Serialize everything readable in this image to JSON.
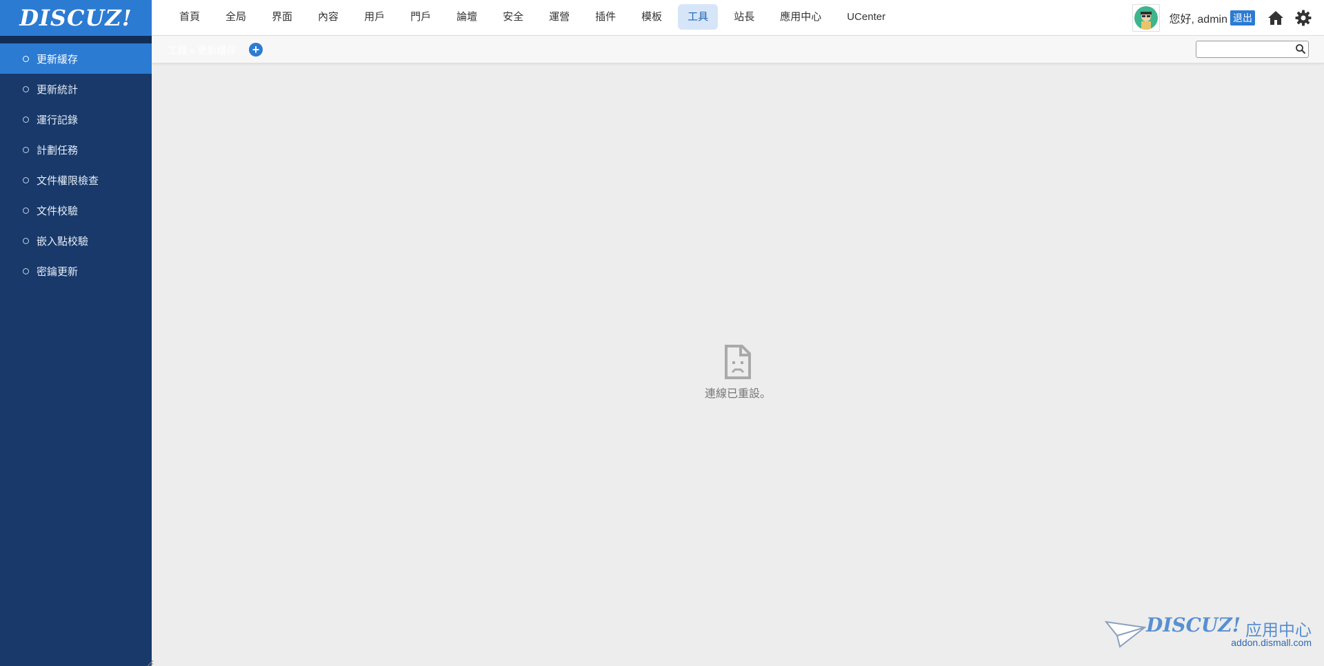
{
  "logo": {
    "text": "DISCUZ!"
  },
  "nav": {
    "items": [
      {
        "label": "首頁",
        "active": false
      },
      {
        "label": "全局",
        "active": false
      },
      {
        "label": "界面",
        "active": false
      },
      {
        "label": "內容",
        "active": false
      },
      {
        "label": "用戶",
        "active": false
      },
      {
        "label": "門戶",
        "active": false
      },
      {
        "label": "論壇",
        "active": false
      },
      {
        "label": "安全",
        "active": false
      },
      {
        "label": "運營",
        "active": false
      },
      {
        "label": "插件",
        "active": false
      },
      {
        "label": "模板",
        "active": false
      },
      {
        "label": "工具",
        "active": true
      },
      {
        "label": "站長",
        "active": false
      },
      {
        "label": "應用中心",
        "active": false
      },
      {
        "label": "UCenter",
        "active": false
      }
    ]
  },
  "user": {
    "greeting": "您好, admin",
    "logout_label": "退出",
    "home_icon": "home-icon",
    "settings_icon": "gear-icon"
  },
  "sidebar": {
    "items": [
      {
        "label": "更新緩存",
        "active": true
      },
      {
        "label": "更新統計",
        "active": false
      },
      {
        "label": "運行記錄",
        "active": false
      },
      {
        "label": "計劃任務",
        "active": false
      },
      {
        "label": "文件權限檢查",
        "active": false
      },
      {
        "label": "文件校驗",
        "active": false
      },
      {
        "label": "嵌入點校驗",
        "active": false
      },
      {
        "label": "密鑰更新",
        "active": false
      }
    ]
  },
  "breadcrumb": {
    "text": "工具 » 更新緩存",
    "add_label": "+"
  },
  "search": {
    "value": "",
    "placeholder": ""
  },
  "main": {
    "error_text": "連線已重設。",
    "error_icon": "broken-page-icon"
  },
  "watermark": {
    "logo": "DISCUZ!",
    "title_cn": "应用中心",
    "url": "addon.dismall.com"
  },
  "colors": {
    "brand": "#2b7bd3",
    "sidebar_bg": "#18396a",
    "nav_active_bg": "#d6e6f8",
    "page_bg": "#ededed"
  }
}
